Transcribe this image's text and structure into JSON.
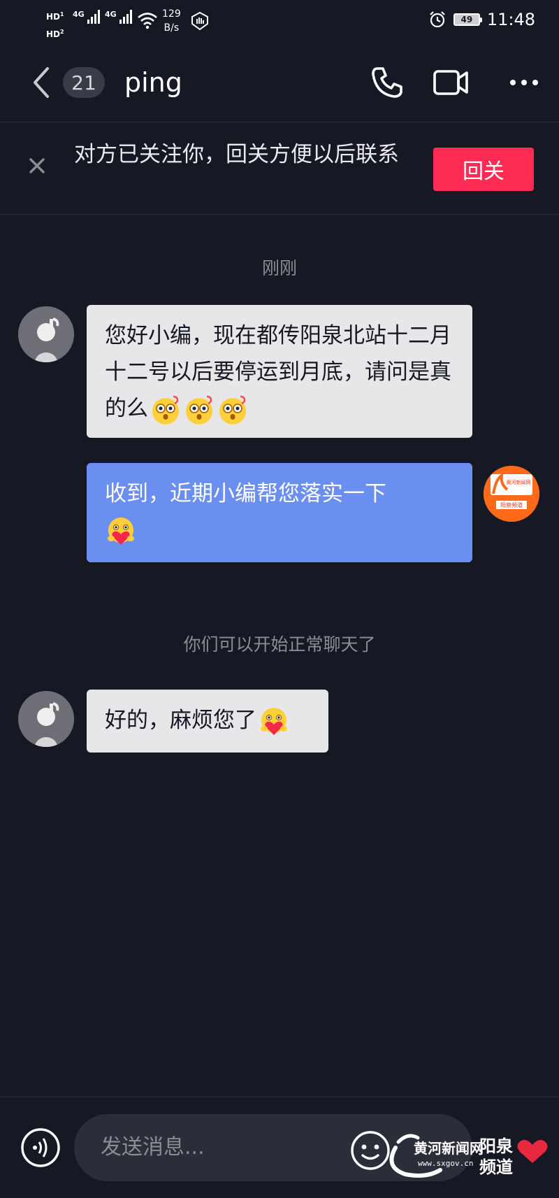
{
  "status_bar": {
    "hd1": "HD",
    "hd2": "HD",
    "sim1": "4G",
    "sim2": "4G",
    "speed_value": "129",
    "speed_unit": "B/s",
    "battery": "49",
    "time": "11:48"
  },
  "header": {
    "unread_count": "21",
    "title": "ping"
  },
  "follow_bar": {
    "text": "对方已关注你，回关方便以后联系",
    "button": "回关"
  },
  "chat": {
    "time_label": "刚刚",
    "messages": [
      {
        "side": "in",
        "text": "您好小编，现在都传阳泉北站十二月十二号以后要停运到月底，请问是真的么"
      },
      {
        "side": "out",
        "text": "收到，近期小编帮您落实一下"
      }
    ],
    "system_notice": "你们可以开始正常聊天了",
    "reply": {
      "side": "in",
      "text": "好的，麻烦您了"
    }
  },
  "brand_avatar": {
    "line1": "黄河新闻网",
    "line2": "阳泉频道"
  },
  "input": {
    "placeholder": "发送消息..."
  },
  "watermark": {
    "name": "黄河新闻网",
    "url": "www.sxgov.cn",
    "channel_line1": "阳泉",
    "channel_line2": "频道"
  },
  "colors": {
    "background": "#161823",
    "accent": "#fe2c55",
    "outgoing_bubble": "#6a8ff0",
    "incoming_bubble": "#e7e7e9"
  }
}
